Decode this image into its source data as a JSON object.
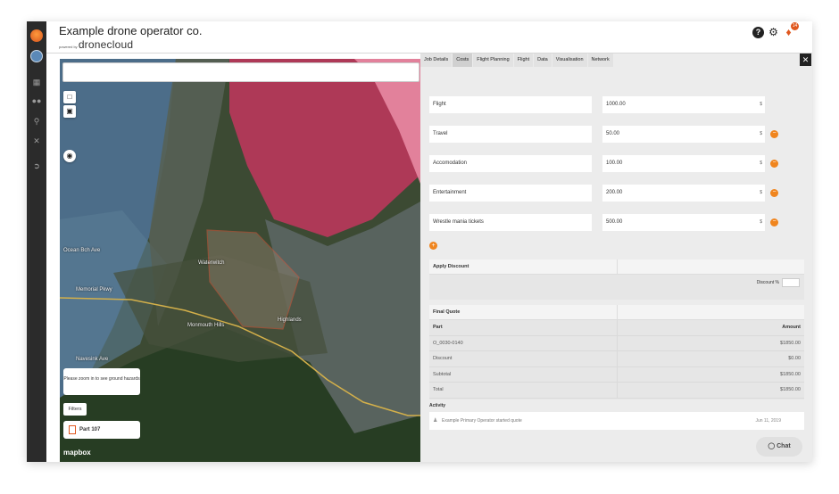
{
  "header": {
    "company": "Example drone operator co.",
    "powered_by": "powered by",
    "brand": "dronecloud",
    "notification_count": "14"
  },
  "map": {
    "labels": [
      "Ocean Bch Ave",
      "Waterwitch",
      "Highlands",
      "Monmouth Hills",
      "Memorial Pkwy",
      "Navesink Ave"
    ],
    "zoom_note": "Please zoom in to see ground hazards",
    "filters_label": "Filters",
    "layer_label": "Part 107",
    "attribution": "mapbox"
  },
  "tabs": [
    "Job Details",
    "Costs",
    "Flight Planning",
    "Flight",
    "Data",
    "Visualisation",
    "Network"
  ],
  "active_tab": "Costs",
  "currency_symbol": "$",
  "costs": [
    {
      "name": "Flight",
      "amount": "1000.00"
    },
    {
      "name": "Travel",
      "amount": "50.00"
    },
    {
      "name": "Accomodation",
      "amount": "100.00"
    },
    {
      "name": "Entertainment",
      "amount": "200.00"
    },
    {
      "name": "Wrestle mania tickets",
      "amount": "500.00"
    }
  ],
  "discount": {
    "title": "Apply Discount",
    "label": "Discount %"
  },
  "quote": {
    "title": "Final Quote",
    "col_part": "Part",
    "col_amount": "Amount",
    "rows": [
      {
        "part": "O_0030-0140",
        "amount": "$1850.00"
      },
      {
        "part": "Discount",
        "amount": "$0.00"
      },
      {
        "part": "Subtotal",
        "amount": "$1850.00"
      },
      {
        "part": "Total",
        "amount": "$1850.00"
      }
    ]
  },
  "activity": {
    "title": "Activity",
    "entry": "Example Primary Operator started quote",
    "date": "Jun 11, 2019"
  },
  "chat_label": "Chat",
  "colors": {
    "accent": "#f0851e",
    "rail": "#2b2b2b",
    "restricted": "#c2365e",
    "water_zone": "#5b8fc4"
  }
}
